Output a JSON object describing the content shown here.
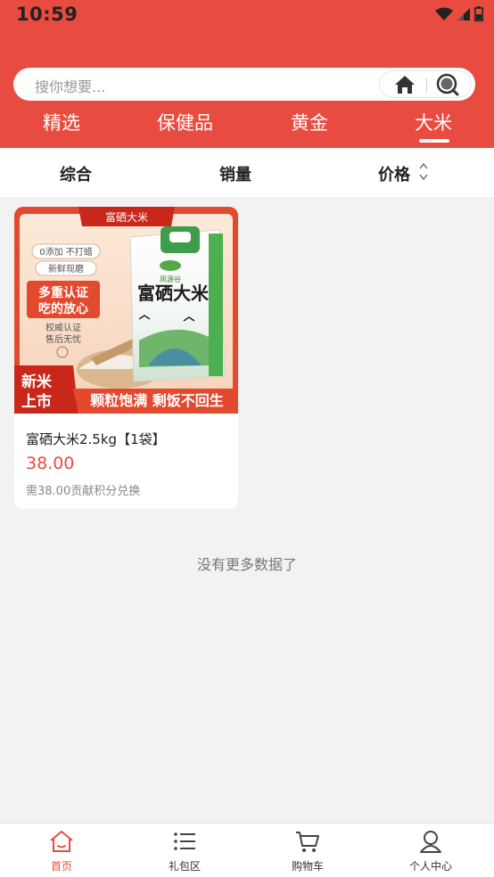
{
  "status_bar": {
    "time": "10:59"
  },
  "search": {
    "placeholder": "搜你想要..."
  },
  "category_tabs": [
    {
      "label": "精选"
    },
    {
      "label": "保健品"
    },
    {
      "label": "黄金"
    },
    {
      "label": "大米",
      "active": true
    }
  ],
  "sort_options": [
    {
      "label": "综合"
    },
    {
      "label": "销量"
    },
    {
      "label": "价格"
    }
  ],
  "products": [
    {
      "name": "富硒大米2.5kg【1袋】",
      "price": "38.00",
      "points_note": "需38.00贡献积分兑换",
      "image": {
        "banner": "富硒大米",
        "tag1": "0添加 不打蜡",
        "tag2": "新鲜现磨",
        "cert_line1": "多重认证",
        "cert_line2": "吃的放心",
        "after_sale1": "权威认证",
        "after_sale2": "售后无忧",
        "bag_title": "富硒大米",
        "brand": "凤源谷",
        "corner1": "新米",
        "corner2": "上市",
        "slogan": "颗粒饱满 剩饭不回生"
      }
    }
  ],
  "footer_note": "没有更多数据了",
  "tabbar": [
    {
      "label": "首页",
      "icon": "home-icon",
      "active": true
    },
    {
      "label": "礼包区",
      "icon": "list-icon"
    },
    {
      "label": "购物车",
      "icon": "cart-icon"
    },
    {
      "label": "个人中心",
      "icon": "user-icon"
    }
  ],
  "colors": {
    "brand_red": "#e84b3f",
    "background": "#f2f2f2",
    "price": "#e84b3f"
  }
}
